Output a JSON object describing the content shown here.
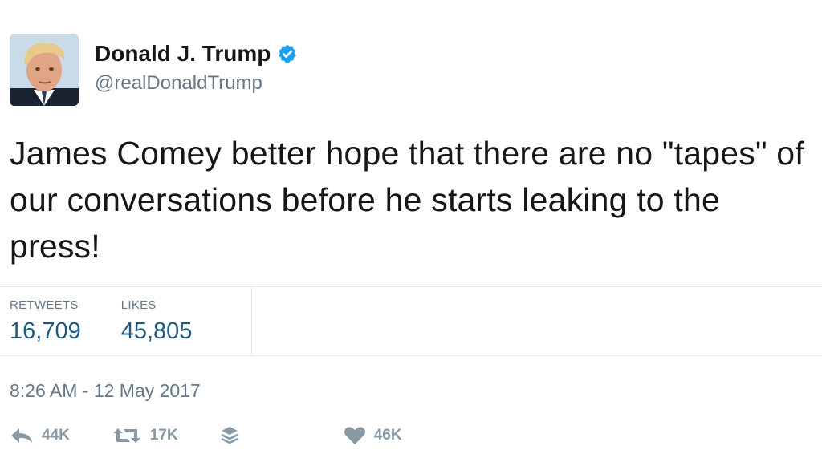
{
  "user": {
    "display_name": "Donald J. Trump",
    "handle": "@realDonaldTrump",
    "verified": true
  },
  "tweet": {
    "text": "James Comey better hope that there are no \"tapes\" of our conversations before he starts leaking to the press!",
    "timestamp": "8:26 AM - 12 May 2017"
  },
  "stats": {
    "retweets_label": "RETWEETS",
    "retweets_value": "16,709",
    "likes_label": "LIKES",
    "likes_value": "45,805"
  },
  "actions": {
    "reply_count": "44K",
    "retweet_count": "17K",
    "like_count": "46K"
  },
  "colors": {
    "verified": "#1da1f2",
    "stat_value": "#1c5b82",
    "muted": "#657786",
    "action": "#8899a6"
  }
}
